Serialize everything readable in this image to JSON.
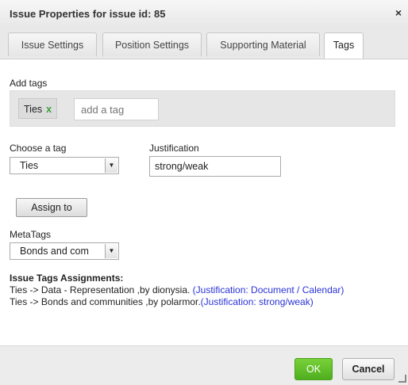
{
  "dialog": {
    "title": "Issue Properties for issue id: 85",
    "close_icon": "×"
  },
  "tabs": [
    {
      "label": "Issue Settings"
    },
    {
      "label": "Position Settings"
    },
    {
      "label": "Supporting Material"
    },
    {
      "label": "Tags",
      "active": true
    }
  ],
  "add_tags": {
    "label": "Add tags",
    "chips": [
      {
        "label": "Ties",
        "remove": "x"
      }
    ],
    "input_placeholder": "add a tag"
  },
  "choose_tag": {
    "label": "Choose a tag",
    "selected": "Ties"
  },
  "justification": {
    "label": "Justification",
    "value": "strong/weak"
  },
  "assign_button": "Assign to",
  "metatags": {
    "label": "MetaTags",
    "selected": "Bonds and com"
  },
  "assignments": {
    "title": "Issue Tags Assignments:",
    "lines": [
      {
        "text": "Ties -> Data - Representation ,by dionysia. ",
        "justification": "(Justification: Document / Calendar)"
      },
      {
        "text": "Ties -> Bonds and communities ,by polarmor.",
        "justification": "(Justification: strong/weak)"
      }
    ]
  },
  "footer": {
    "ok_label": "OK",
    "cancel_label": "Cancel"
  },
  "colors": {
    "ok_green": "#5cb82a",
    "justification_link": "#2a33d6"
  }
}
